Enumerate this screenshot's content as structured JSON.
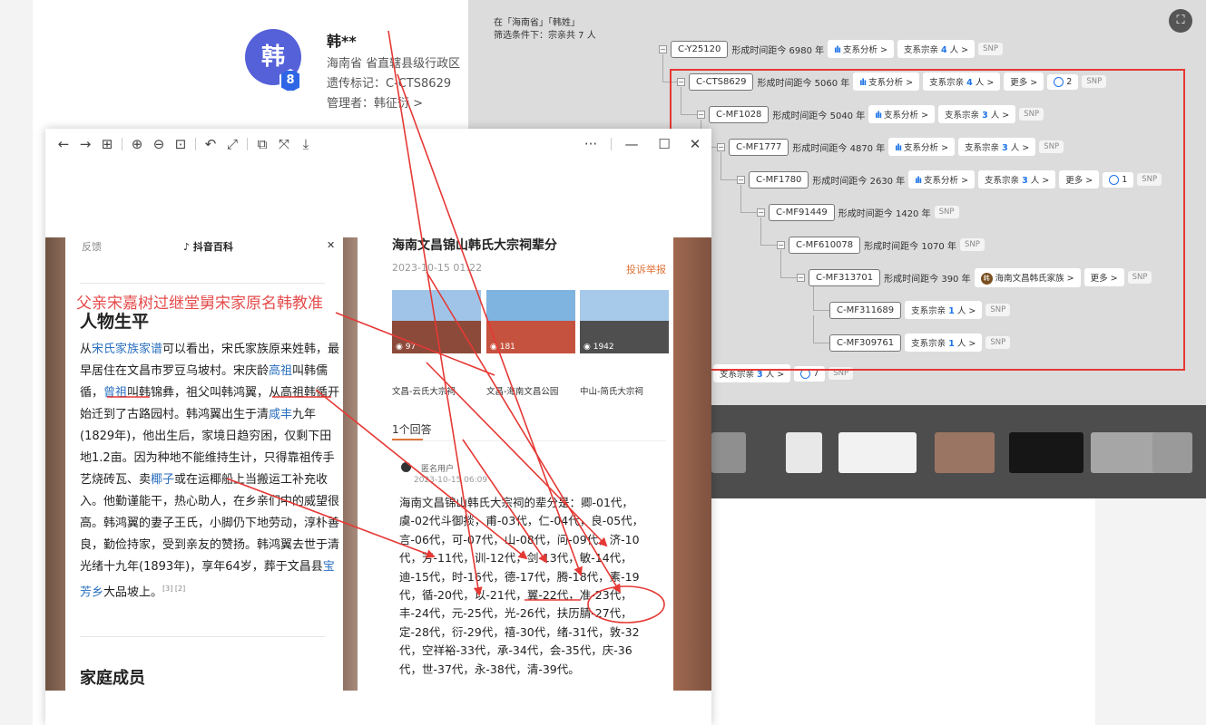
{
  "profile": {
    "avatar_char": "韩",
    "badge_char": "8",
    "name": "韩**",
    "region": "海南省 省直辖县级行政区",
    "marker": "遗传标记：C-CTS8629",
    "admin": "管理者：韩征衍 >"
  },
  "tree": {
    "header_line1": "在「海南省」「韩姓」",
    "header_line2": "筛选条件下：宗亲共 7 人",
    "scan_icon": "⛶",
    "nodes": [
      {
        "id": "C-Y25120",
        "age": "形成时间距今 6980 年",
        "analysis": "支系分析 >",
        "kin_prefix": "支系宗亲",
        "kin_num": "4",
        "kin_suffix": "人 >",
        "more": "",
        "q": "",
        "clan": "",
        "snp": "SNP"
      },
      {
        "id": "C-CTS8629",
        "age": "形成时间距今 5060 年",
        "analysis": "支系分析 >",
        "kin_prefix": "支系宗亲",
        "kin_num": "4",
        "kin_suffix": "人 >",
        "more": "更多 >",
        "q": "2",
        "clan": "",
        "snp": "SNP"
      },
      {
        "id": "C-MF1028",
        "age": "形成时间距今 5040 年",
        "analysis": "支系分析 >",
        "kin_prefix": "支系宗亲",
        "kin_num": "3",
        "kin_suffix": "人 >",
        "more": "",
        "q": "",
        "clan": "",
        "snp": "SNP"
      },
      {
        "id": "C-MF1777",
        "age": "形成时间距今 4870 年",
        "analysis": "支系分析 >",
        "kin_prefix": "支系宗亲",
        "kin_num": "3",
        "kin_suffix": "人 >",
        "more": "",
        "q": "",
        "clan": "",
        "snp": "SNP"
      },
      {
        "id": "C-MF1780",
        "age": "形成时间距今 2630 年",
        "analysis": "支系分析 >",
        "kin_prefix": "支系宗亲",
        "kin_num": "3",
        "kin_suffix": "人 >",
        "more": "更多 >",
        "q": "1",
        "clan": "",
        "snp": "SNP"
      },
      {
        "id": "C-MF91449",
        "age": "形成时间距今 1420 年",
        "analysis": "",
        "kin_prefix": "",
        "kin_num": "",
        "kin_suffix": "",
        "more": "",
        "q": "",
        "clan": "",
        "snp": "SNP"
      },
      {
        "id": "C-MF610078",
        "age": "形成时间距今 1070 年",
        "analysis": "",
        "kin_prefix": "",
        "kin_num": "",
        "kin_suffix": "",
        "more": "",
        "q": "",
        "clan": "",
        "snp": "SNP"
      },
      {
        "id": "C-MF313701",
        "age": "形成时间距今 390 年",
        "analysis": "",
        "kin_prefix": "",
        "kin_num": "",
        "kin_suffix": "",
        "more": "更多 >",
        "q": "",
        "clan": "海南文昌韩氏家族 >",
        "snp": "SNP"
      },
      {
        "id": "C-MF311689",
        "age": "",
        "analysis": "",
        "kin_prefix": "支系宗亲",
        "kin_num": "1",
        "kin_suffix": "人 >",
        "more": "",
        "q": "",
        "clan": "",
        "snp": "SNP"
      },
      {
        "id": "C-MF309761",
        "age": "",
        "analysis": "",
        "kin_prefix": "支系宗亲",
        "kin_num": "1",
        "kin_suffix": "人 >",
        "more": "",
        "q": "",
        "clan": "",
        "snp": "SNP"
      }
    ],
    "below_pill": {
      "kin_prefix": "支系宗亲",
      "kin_num": "3",
      "kin_suffix": "人 >",
      "q": "7",
      "snp": "SNP"
    }
  },
  "viewer": {
    "toolbar_icons": [
      "←",
      "→",
      "⊞",
      "⊕",
      "⊖",
      "⊡",
      "↶",
      "⤢",
      "⧉",
      "⤧",
      "⤓"
    ],
    "more_icon": "···",
    "min_icon": "—",
    "max_icon": "☐",
    "close_icon": "✕"
  },
  "article": {
    "top_left": "反馈",
    "top_mid": "♪ 抖音百科",
    "top_close": "✕",
    "overlay": "父亲宋嘉树过继堂舅宋家原名韩教准",
    "life_heading": "人物生平",
    "bio": [
      {
        "t": "从",
        "k": ""
      },
      {
        "t": "宋氏家族家谱",
        "k": "link"
      },
      {
        "t": "可以看出，宋氏家族原来姓韩，最早居住在文昌市罗豆乌坡村。宋庆龄",
        "k": ""
      },
      {
        "t": "高祖",
        "k": "link"
      },
      {
        "t": "叫韩儒循，",
        "k": ""
      },
      {
        "t": "曾祖",
        "k": "link"
      },
      {
        "t": "叫韩锦彝，祖父叫韩鸿翼，从高祖韩循开始迁到了古路园村。韩鸿翼出生于清",
        "k": ""
      },
      {
        "t": "咸丰",
        "k": "link"
      },
      {
        "t": "九年(1829年)，他出生后，家境日趋穷困，仅剩下田地1.2亩。因为种地不能维持生计，只得靠祖传手艺烧砖瓦、卖",
        "k": ""
      },
      {
        "t": "椰子",
        "k": "link"
      },
      {
        "t": "或在运椰船上当搬运工补充收入。他勤谨能干，热心助人，在乡亲们中的威望很高。韩鸿翼的妻子王氏，小脚仍下地劳动，淳朴善良，勤俭持家，受到亲友的赞扬。韩鸿翼去世于清光绪十九年(1893年)，享年64岁，葬于文昌县",
        "k": ""
      },
      {
        "t": "宝芳乡",
        "k": "link"
      },
      {
        "t": "大品坡上。",
        "k": ""
      },
      {
        "t": "[3] [2]",
        "k": "sup"
      }
    ],
    "family_heading": "家庭成员"
  },
  "qa": {
    "title": "海南文昌锦山韩氏大宗祠辈分",
    "date": "2023-10-15 01:22",
    "report": "投诉举报",
    "thumbs": [
      {
        "views": "◉ 97",
        "caption": "文昌-云氏大宗祠",
        "sky": "#9fc4e8",
        "bld": "#8c4a3a"
      },
      {
        "views": "◉ 181",
        "caption": "文昌-海南文昌公园",
        "sky": "#7fb3e0",
        "bld": "#c5523e"
      },
      {
        "views": "◉ 1942",
        "caption": "中山-简氏大宗祠",
        "sky": "#a7c9ea",
        "bld": "#4f4f4f"
      }
    ],
    "answers_count": "1个回答",
    "anon_name": "匿名用户",
    "anon_time": "2023-10-15 06:09",
    "answer_text": "海南文昌锦山韩氏大宗祠的辈分是：卿-01代，虞-02代斗御掞，甫-03代，仁-04代，良-05代，言-06代，可-07代，山-08代，问-09代，济-10代，芳-11代，训-12代，剑-13代，敏-14代，迪-15代，时-16代，德-17代，腾-18代，素-19代，循-20代，以-21代，翼-22代，准-23代，丰-24代，元-25代，光-26代，扶历腈-27代，定-28代，衍-29代，禧-30代，绪-31代，敦-32代，空祥裕-33代，承-34代，会-35代，庆-36代，世-37代，永-38代，清-39代。"
  },
  "colors": {
    "accent_blue": "#1e73e8",
    "annotation_red": "#e53935",
    "avatar_purple": "#5561d8",
    "report_orange": "#e0743a"
  }
}
